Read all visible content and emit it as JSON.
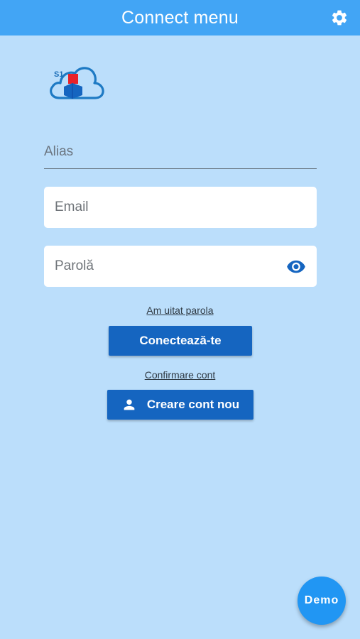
{
  "header": {
    "title": "Connect menu",
    "settings_icon": "gear-icon"
  },
  "logo": {
    "text": "S1",
    "colors": {
      "cloud": "#1e7ac4",
      "box_red": "#e8222a",
      "box_blue": "#1565c0"
    }
  },
  "form": {
    "alias_placeholder": "Alias",
    "email_placeholder": "Email",
    "password_placeholder": "Parolă",
    "password_toggle_icon": "eye-icon"
  },
  "links": {
    "forgot_password": "Am uitat parola",
    "confirm_account": "Confirmare cont"
  },
  "buttons": {
    "connect": "Conectează-te",
    "create_account": "Creare cont nou",
    "create_account_icon": "person-icon",
    "demo": "Demo"
  },
  "colors": {
    "background": "#bbdefb",
    "header": "#42a5f5",
    "primary_button": "#1565c0",
    "fab": "#2196f3"
  }
}
